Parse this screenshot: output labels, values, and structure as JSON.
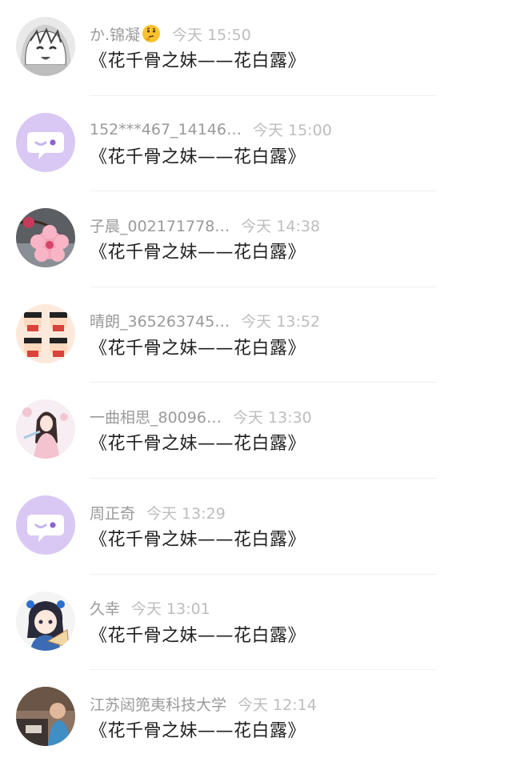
{
  "comments": [
    {
      "name": "か.锦凝",
      "time": "今天 15:50",
      "text": "《花千骨之妹——花白露》",
      "avatar": "anime-girl-avatar"
    },
    {
      "name": "152***467_14146…",
      "time": "今天 15:00",
      "text": "《花千骨之妹——花白露》",
      "avatar": "default-chat-avatar"
    },
    {
      "name": "子晨_002171778…",
      "time": "今天 14:38",
      "text": "《花千骨之妹——花白露》",
      "avatar": "blossom-avatar"
    },
    {
      "name": "晴朗_365263745…",
      "time": "今天 13:52",
      "text": "《花千骨之妹——花白露》",
      "avatar": "cartoon-kid-avatar"
    },
    {
      "name": "一曲相思_80096…",
      "time": "今天 13:30",
      "text": "《花千骨之妹——花白露》",
      "avatar": "painted-lady-avatar"
    },
    {
      "name": "周正奇",
      "time": "今天 13:29",
      "text": "《花千骨之妹——花白露》",
      "avatar": "default-chat-avatar"
    },
    {
      "name": "久幸",
      "time": "今天 13:01",
      "text": "《花千骨之妹——花白露》",
      "avatar": "chibi-fan-avatar"
    },
    {
      "name": "江苏闼篼夷科技大学",
      "time": "今天 12:14",
      "text": "《花千骨之妹——花白露》",
      "avatar": "photo-avatar"
    }
  ],
  "colors": {
    "default_avatar_bg": "#d9c8f4",
    "name": "#9a9a9a",
    "time": "#bdbdbd",
    "text": "#1f1f1f"
  }
}
